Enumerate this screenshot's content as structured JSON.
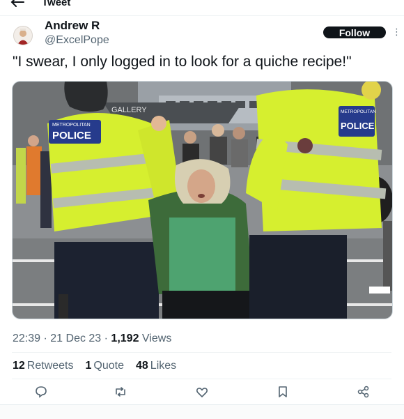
{
  "header": {
    "title": "Tweet",
    "back_icon": "arrow-left-icon"
  },
  "author": {
    "name": "Andrew R",
    "handle": "@ExcelPope",
    "follow_label": "Follow",
    "more_icon": "more-vertical-icon"
  },
  "tweet": {
    "text": "\"I swear, I only logged in to look for a quiche recipe!\""
  },
  "photo": {
    "vest_text_left": "POLICE",
    "vest_top_left": "METROPOLITAN",
    "vest_text_right": "POLICE",
    "vest_top_right": "METROPOLITAN",
    "building_sign": "GALLERY"
  },
  "meta": {
    "time": "22:39",
    "date": "21 Dec 23",
    "views_count": "1,192",
    "views_label": "Views"
  },
  "stats": {
    "retweets_count": "12",
    "retweets_label": "Retweets",
    "quotes_count": "1",
    "quotes_label": "Quote",
    "likes_count": "48",
    "likes_label": "Likes"
  },
  "actions": [
    "reply-icon",
    "retweet-icon",
    "like-icon",
    "bookmark-icon",
    "share-icon"
  ],
  "colors": {
    "follow_bg": "#0f1419",
    "secondary_text": "#536471",
    "vest": "#d6ef2f"
  }
}
